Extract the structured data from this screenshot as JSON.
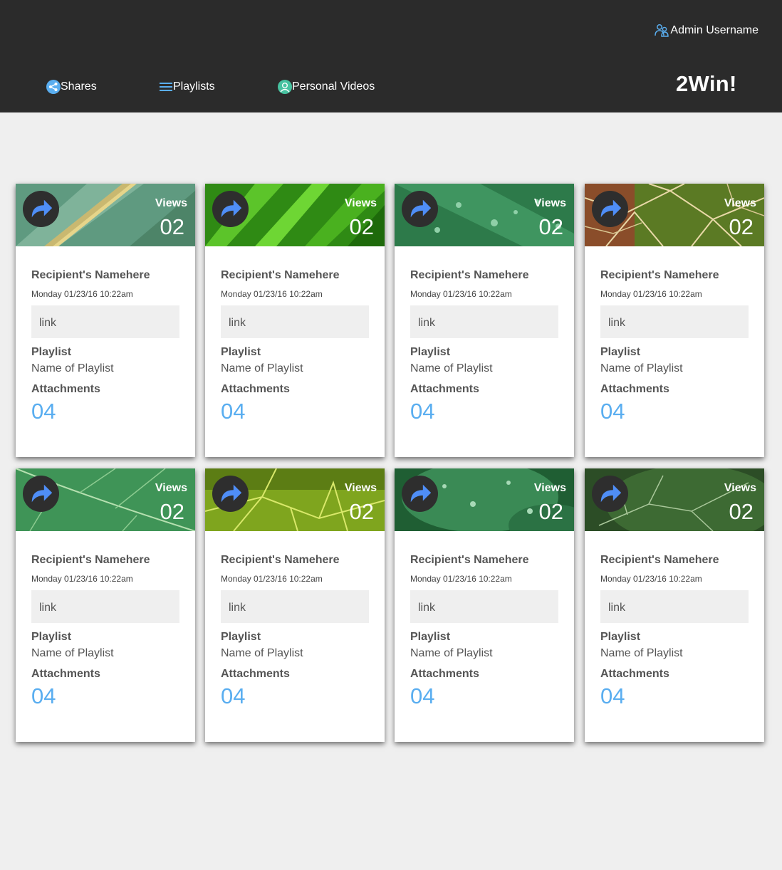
{
  "header": {
    "admin_name": "Admin Username",
    "brand": "2Win!",
    "nav": [
      {
        "label": "Shares",
        "icon": "share-icon"
      },
      {
        "label": "Playlists",
        "icon": "menu-icon"
      },
      {
        "label": "Personal Videos",
        "icon": "user-icon"
      }
    ]
  },
  "colors": {
    "header_bg": "#2b2b2b",
    "accent": "#5aaef0",
    "page_bg": "#efefef"
  },
  "labels": {
    "views": "Views",
    "playlist": "Playlist",
    "attachments": "Attachments"
  },
  "cards": [
    {
      "views": "02",
      "recipient": "Recipient's Namehere",
      "date": "Monday 01/23/16 10:22am",
      "link": "link",
      "playlist": "Name of Playlist",
      "attachments": "04"
    },
    {
      "views": "02",
      "recipient": "Recipient's Namehere",
      "date": "Monday 01/23/16 10:22am",
      "link": "link",
      "playlist": "Name of Playlist",
      "attachments": "04"
    },
    {
      "views": "02",
      "recipient": "Recipient's Namehere",
      "date": "Monday 01/23/16 10:22am",
      "link": "link",
      "playlist": "Name of Playlist",
      "attachments": "04"
    },
    {
      "views": "02",
      "recipient": "Recipient's Namehere",
      "date": "Monday 01/23/16 10:22am",
      "link": "link",
      "playlist": "Name of Playlist",
      "attachments": "04"
    },
    {
      "views": "02",
      "recipient": "Recipient's Namehere",
      "date": "Monday 01/23/16 10:22am",
      "link": "link",
      "playlist": "Name of Playlist",
      "attachments": "04"
    },
    {
      "views": "02",
      "recipient": "Recipient's Namehere",
      "date": "Monday 01/23/16 10:22am",
      "link": "link",
      "playlist": "Name of Playlist",
      "attachments": "04"
    },
    {
      "views": "02",
      "recipient": "Recipient's Namehere",
      "date": "Monday 01/23/16 10:22am",
      "link": "link",
      "playlist": "Name of Playlist",
      "attachments": "04"
    },
    {
      "views": "02",
      "recipient": "Recipient's Namehere",
      "date": "Monday 01/23/16 10:22am",
      "link": "link",
      "playlist": "Name of Playlist",
      "attachments": "04"
    }
  ]
}
